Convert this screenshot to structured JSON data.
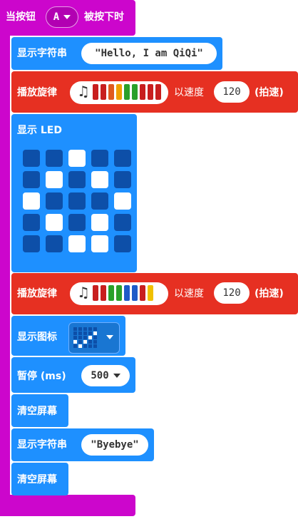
{
  "event_block": {
    "label_before": "当按钮",
    "button_value": "A",
    "label_after": "被按下时"
  },
  "blocks": {
    "show_string_1": {
      "label": "显示字符串",
      "value": "\"Hello, I am QiQi\""
    },
    "play_melody_1": {
      "label": "播放旋律",
      "speed_label": "以速度",
      "speed_value": "120",
      "unit": "(拍速)",
      "note_colors": [
        "#c81e1e",
        "#c81e1e",
        "#e05a1e",
        "#f0a000",
        "#2aa02a",
        "#2aa02a",
        "#c81e1e",
        "#c81e1e",
        "#c81e1e"
      ]
    },
    "show_led": {
      "label": "显示 LED",
      "grid": [
        [
          0,
          0,
          1,
          0,
          0
        ],
        [
          0,
          1,
          0,
          1,
          0
        ],
        [
          1,
          0,
          0,
          0,
          1
        ],
        [
          0,
          1,
          0,
          1,
          0
        ],
        [
          0,
          0,
          1,
          1,
          0
        ]
      ]
    },
    "play_melody_2": {
      "label": "播放旋律",
      "speed_label": "以速度",
      "speed_value": "120",
      "unit": "(拍速)",
      "note_colors": [
        "#c81e1e",
        "#c81e1e",
        "#2aa02a",
        "#2aa02a",
        "#1e5ac8",
        "#1e5ac8",
        "#c81e1e",
        "#f0c000"
      ]
    },
    "show_icon": {
      "label": "显示图标",
      "icon": "checkmark-led-icon"
    },
    "pause": {
      "label": "暂停 (ms)",
      "value": "500"
    },
    "clear_1": {
      "label": "清空屏幕"
    },
    "show_string_2": {
      "label": "显示字符串",
      "value": "\"Byebye\""
    },
    "clear_2": {
      "label": "清空屏幕"
    }
  },
  "colors": {
    "event": "#cc06cc",
    "basic": "#1e90ff",
    "music": "#e63022",
    "led_on": "#ffffff",
    "led_off": "#0d4fa8"
  }
}
